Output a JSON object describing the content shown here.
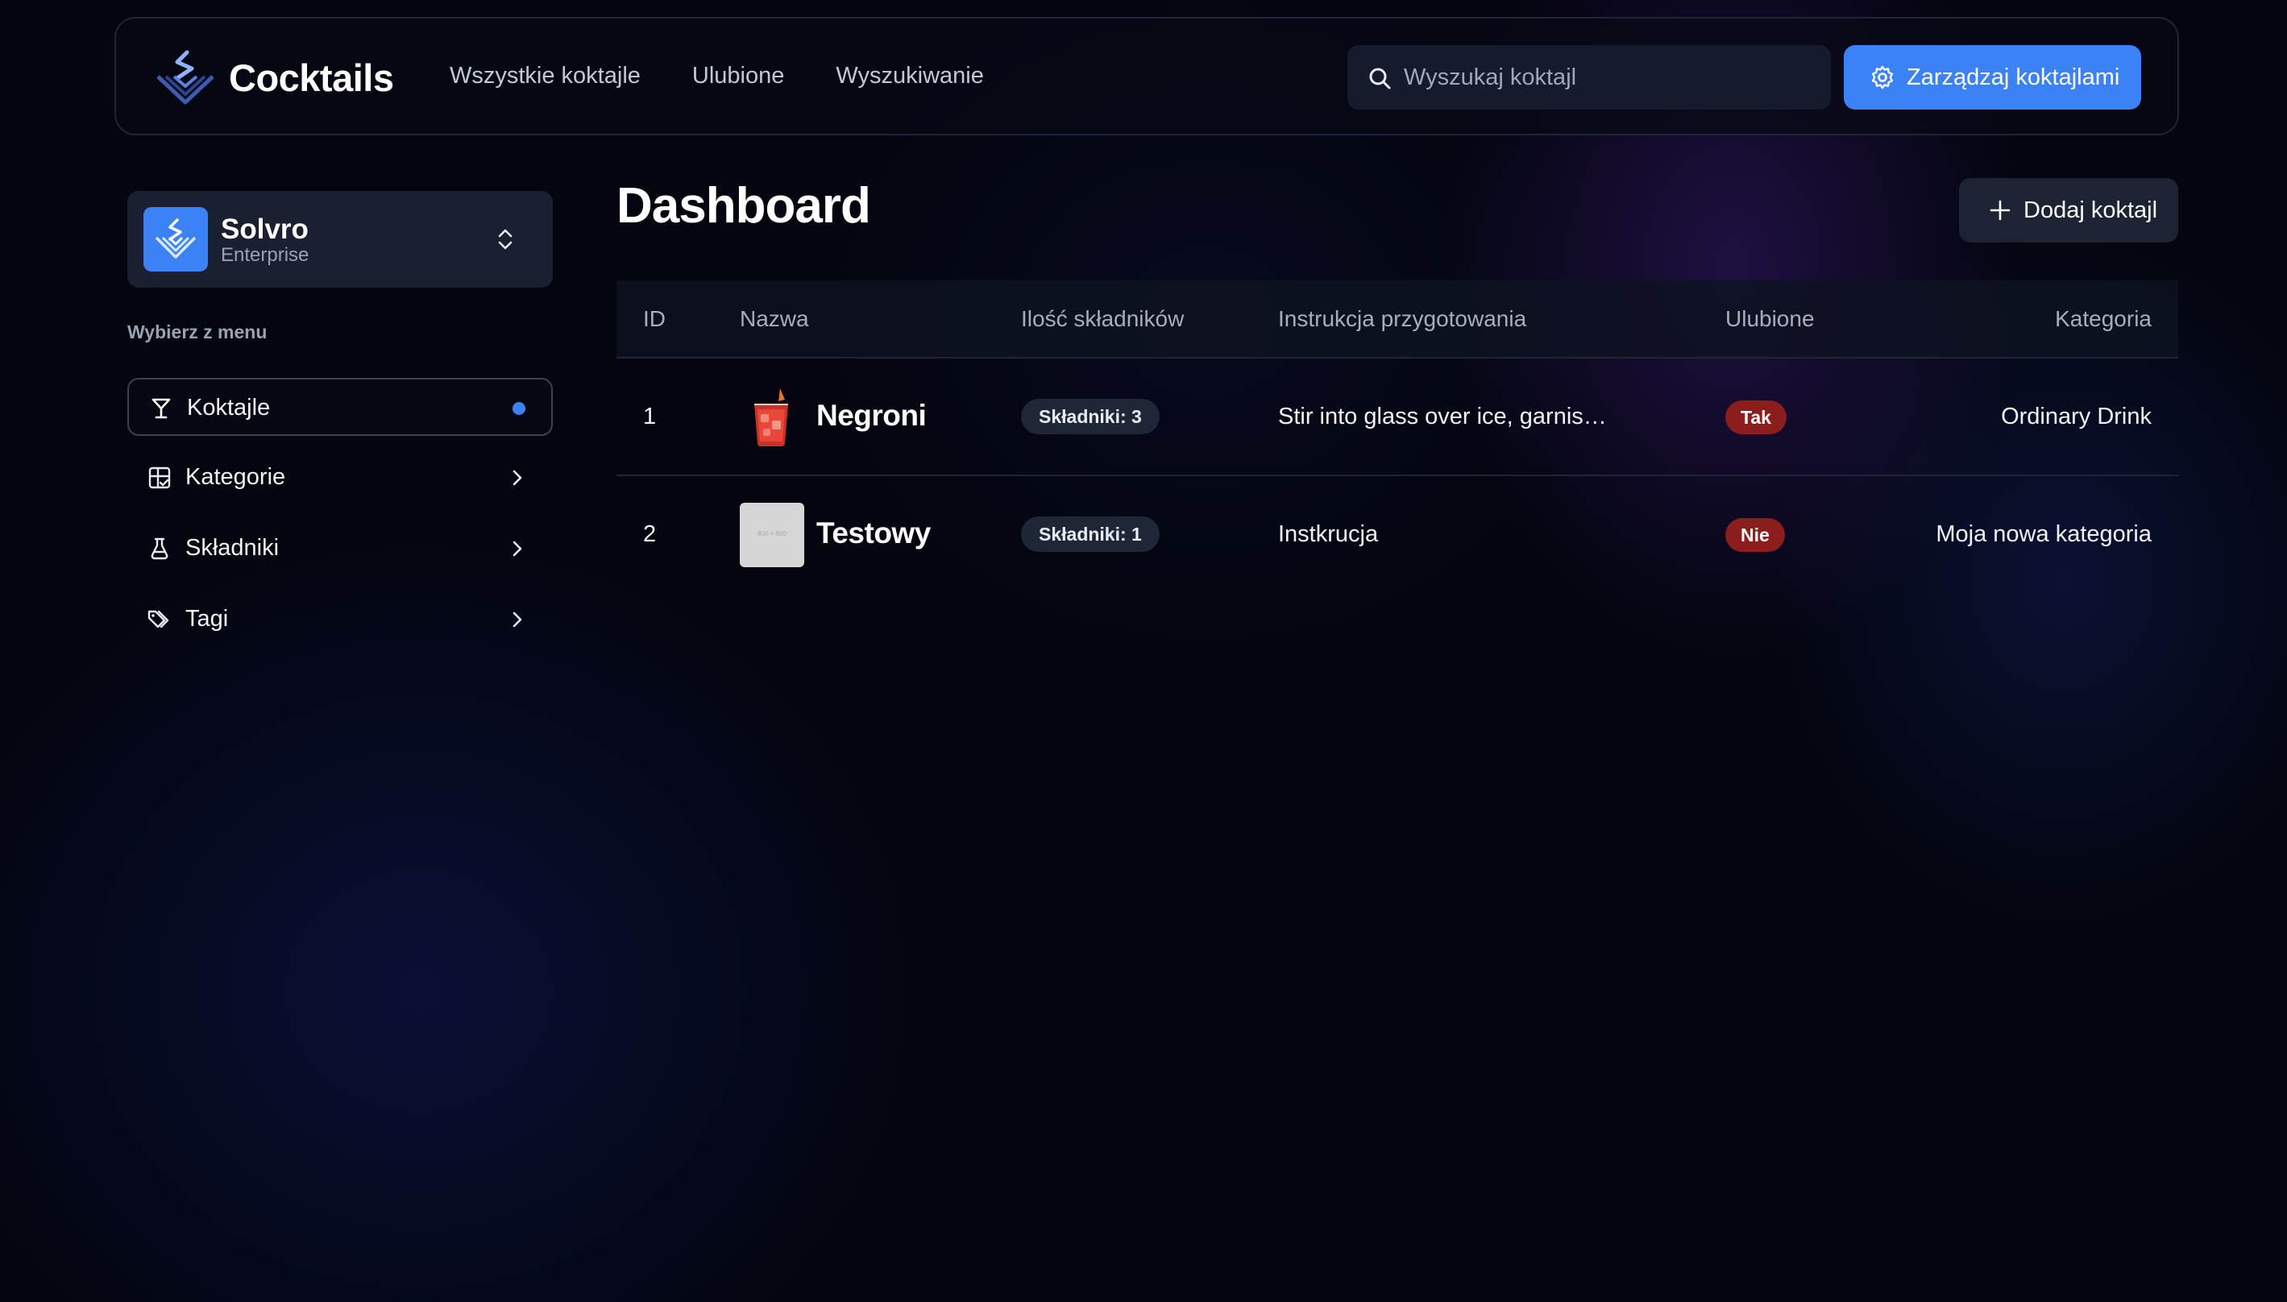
{
  "app": {
    "brand_name": "Cocktails"
  },
  "nav": {
    "items": [
      {
        "label": "Wszystkie koktajle"
      },
      {
        "label": "Ulubione"
      },
      {
        "label": "Wyszukiwanie"
      }
    ]
  },
  "search": {
    "placeholder": "Wyszukaj koktajl",
    "value": ""
  },
  "header": {
    "manage_label": "Zarządzaj koktajlami"
  },
  "team": {
    "name": "Solvro",
    "plan": "Enterprise"
  },
  "sidebar": {
    "caption": "Wybierz z menu",
    "items": [
      {
        "label": "Koktajle",
        "icon": "cocktail-glass-icon",
        "active": true
      },
      {
        "label": "Kategorie",
        "icon": "grid-check-icon",
        "active": false
      },
      {
        "label": "Składniki",
        "icon": "flask-icon",
        "active": false
      },
      {
        "label": "Tagi",
        "icon": "tags-icon",
        "active": false
      }
    ]
  },
  "main": {
    "title": "Dashboard",
    "add_label": "Dodaj koktajl",
    "columns": [
      "ID",
      "Nazwa",
      "Ilość składników",
      "Instrukcja przygotowania",
      "Ulubione",
      "Kategoria"
    ],
    "rows": [
      {
        "id": "1",
        "name": "Negroni",
        "thumb": "negroni-drink-photo",
        "ingredients": "Składniki: 3",
        "instructions": "Stir into glass over ice, garnis…",
        "favorite": "Tak",
        "category": "Ordinary Drink"
      },
      {
        "id": "2",
        "name": "Testowy",
        "thumb": "placeholder-image",
        "thumb_text": "800 × 800",
        "ingredients": "Składniki: 1",
        "instructions": "Instkrucja",
        "favorite": "Nie",
        "category": "Moja nowa kategoria"
      }
    ]
  },
  "colors": {
    "accent": "#3b82f6",
    "background": "#03050f",
    "favorite_badge": "#8b1d1d",
    "pill": "#1f2636"
  }
}
